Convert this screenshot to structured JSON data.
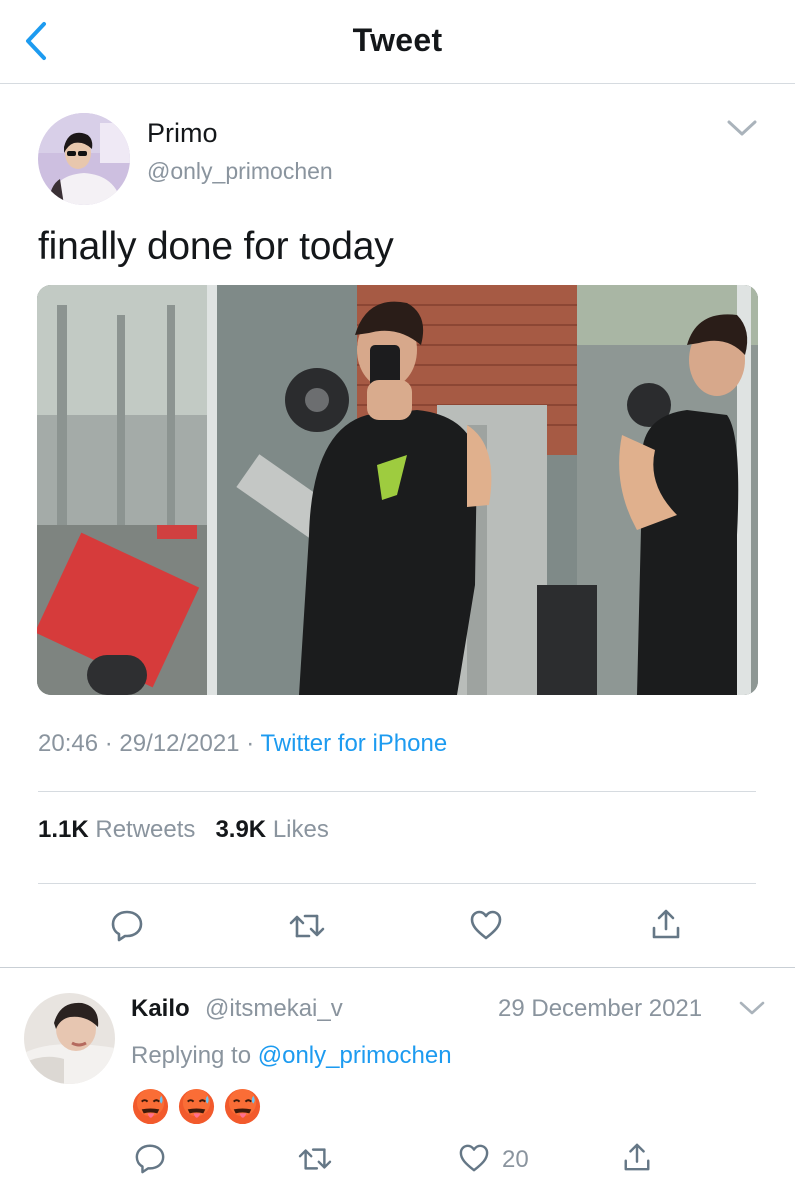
{
  "header": {
    "title": "Tweet",
    "back_icon": "chevron-left-icon"
  },
  "tweet": {
    "author_name": "Primo",
    "author_handle": "@only_primochen",
    "text": "finally done for today",
    "time": "20:46",
    "date": "29/12/2021",
    "source": "Twitter for iPhone",
    "retweets_count": "1.1K",
    "retweets_label": "Retweets",
    "likes_count": "3.9K",
    "likes_label": "Likes",
    "actions": [
      "reply-icon",
      "retweet-icon",
      "heart-icon",
      "share-icon"
    ]
  },
  "reply": {
    "author_name": "Kailo",
    "author_handle": "@itsmekai_v",
    "date": "29 December 2021",
    "replying_prefix": "Replying to",
    "replying_to": "@only_primochen",
    "emojis": [
      "hot-face-emoji",
      "hot-face-emoji",
      "hot-face-emoji"
    ],
    "like_count": "20"
  },
  "colors": {
    "accent": "#1d9bf0",
    "secondary_text": "#8a949e",
    "divider": "#d6dbe0"
  }
}
